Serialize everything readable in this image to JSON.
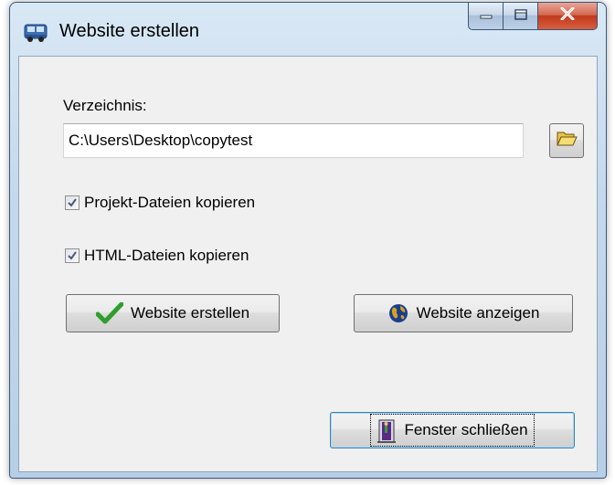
{
  "window": {
    "title": "Website erstellen",
    "app_icon": "bus-icon",
    "controls": {
      "minimize_icon": "minimize-icon",
      "maximize_icon": "maximize-icon",
      "close_icon": "close-icon"
    }
  },
  "directory": {
    "label": "Verzeichnis:",
    "value": "C:\\Users\\Desktop\\copytest",
    "browse_icon": "folder-open-icon"
  },
  "options": {
    "project_files": {
      "label": "Projekt-Dateien kopieren",
      "checked": true
    },
    "html_files": {
      "label": "HTML-Dateien kopieren",
      "checked": true
    }
  },
  "buttons": {
    "create_label": "Website erstellen",
    "create_icon": "checkmark-icon",
    "show_label": "Website anzeigen",
    "show_icon": "globe-icon",
    "close_label": "Fenster schließen",
    "close_icon": "exit-door-icon"
  },
  "colors": {
    "checkmark_green": "#2e9e2e",
    "close_button_red": "#c2391c",
    "title_bar_blue": "#c4d9ec"
  }
}
